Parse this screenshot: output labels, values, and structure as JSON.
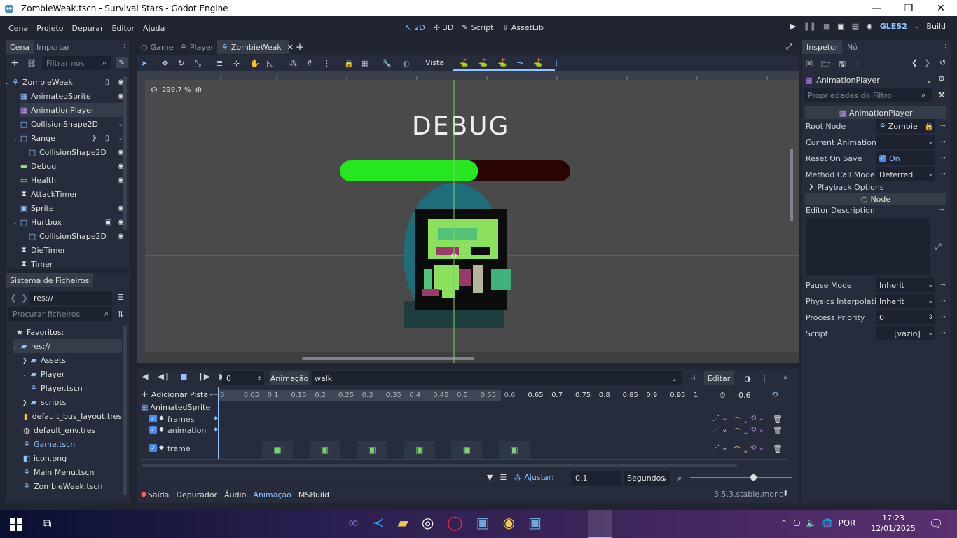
{
  "window": {
    "title": "ZombieWeak.tscn - Survival Stars - Godot Engine",
    "minimize": "—",
    "maximize": "❐",
    "close": "✕"
  },
  "menu": [
    "Cena",
    "Projeto",
    "Depurar",
    "Editor",
    "Ajuda"
  ],
  "workspaces": [
    "2D",
    "3D",
    "Script",
    "AssetLib"
  ],
  "renderer": "GLES2",
  "build_label": "Build",
  "scene_dock": {
    "tabs": [
      "Cena",
      "Importar"
    ],
    "filter_placeholder": "Filtrar nós",
    "nodes": [
      {
        "name": "ZombieWeak",
        "depth": 0,
        "icon": "kinematic-icon"
      },
      {
        "name": "AnimatedSprite",
        "depth": 1,
        "icon": "animsprite-icon"
      },
      {
        "name": "AnimationPlayer",
        "depth": 1,
        "icon": "animplayer-icon"
      },
      {
        "name": "CollisionShape2D",
        "depth": 1,
        "icon": "collision-icon"
      },
      {
        "name": "Range",
        "depth": 1,
        "icon": "area-icon"
      },
      {
        "name": "CollisionShape2D",
        "depth": 2,
        "icon": "collision-icon"
      },
      {
        "name": "Debug",
        "depth": 1,
        "icon": "label-icon"
      },
      {
        "name": "Health",
        "depth": 1,
        "icon": "progress-icon"
      },
      {
        "name": "AttackTimer",
        "depth": 1,
        "icon": "timer-icon"
      },
      {
        "name": "Sprite",
        "depth": 1,
        "icon": "sprite-icon"
      },
      {
        "name": "Hurtbox",
        "depth": 1,
        "icon": "area-icon"
      },
      {
        "name": "CollisionShape2D",
        "depth": 2,
        "icon": "collision-icon"
      },
      {
        "name": "DieTimer",
        "depth": 1,
        "icon": "timer-icon"
      },
      {
        "name": "Timer",
        "depth": 1,
        "icon": "timer-icon"
      }
    ]
  },
  "filesystem_dock": {
    "title": "Sistema de Ficheiros",
    "path": "res://",
    "search_placeholder": "Procurar ficheiros",
    "items": [
      {
        "name": "Favoritos:",
        "depth": 0,
        "icon": "star-icon"
      },
      {
        "name": "res://",
        "depth": 0,
        "icon": "folder-icon"
      },
      {
        "name": "Assets",
        "depth": 1,
        "icon": "folder-icon"
      },
      {
        "name": "Player",
        "depth": 1,
        "icon": "folder-icon"
      },
      {
        "name": "Player.tscn",
        "depth": 2,
        "icon": "scene-file-icon"
      },
      {
        "name": "scripts",
        "depth": 1,
        "icon": "folder-icon"
      },
      {
        "name": "default_bus_layout.tres",
        "depth": 1,
        "icon": "bus-icon"
      },
      {
        "name": "default_env.tres",
        "depth": 1,
        "icon": "env-icon"
      },
      {
        "name": "Game.tscn",
        "depth": 1,
        "icon": "scene-file-icon"
      },
      {
        "name": "icon.png",
        "depth": 1,
        "icon": "image-file-icon"
      },
      {
        "name": "Main Menu.tscn",
        "depth": 1,
        "icon": "scene-file-icon"
      },
      {
        "name": "ZombieWeak.tscn",
        "depth": 1,
        "icon": "scene-file-icon"
      }
    ]
  },
  "scene_tabs": [
    "Game",
    "Player",
    "ZombieWeak"
  ],
  "toolbar": {
    "view_label": "Vista"
  },
  "viewport": {
    "zoom": "299.7 %",
    "debug_label": "DEBUG",
    "health_fraction": 0.6
  },
  "animation": {
    "frame": "0",
    "anim_label": "Animação",
    "anim_name": "walk",
    "edit_label": "Editar",
    "add_track": "Adicionar Pista",
    "length": "0.6",
    "ticks": [
      "0",
      "0.05",
      "0.1",
      "0.15",
      "0.2",
      "0.25",
      "0.3",
      "0.35",
      "0.4",
      "0.45",
      "0.5",
      "0.55",
      "0.6",
      "0.65",
      "0.7",
      "0.75",
      "0.8",
      "0.85",
      "0.9",
      "0.95",
      "1"
    ],
    "track_group": "AnimatedSprite",
    "tracks": [
      "frames",
      "animation",
      "frame"
    ],
    "snap_label": "Ajustar:",
    "snap_value": "0.1",
    "snap_unit": "Segundos"
  },
  "bottom_tabs": [
    "Saída",
    "Depurador",
    "Áudio",
    "Animação",
    "MSBuild"
  ],
  "version": "3.5.3.stable.mono",
  "inspector": {
    "tabs": [
      "Inspetor",
      "Nó"
    ],
    "object": "AnimationPlayer",
    "filter_placeholder": "Propriedades do Filtro",
    "class_header": "AnimationPlayer",
    "props": [
      {
        "label": "Root Node",
        "value": "Zombie"
      },
      {
        "label": "Current Animation",
        "value": ""
      },
      {
        "label": "Reset On Save",
        "value": "On"
      },
      {
        "label": "Method Call Mode",
        "value": "Deferred"
      }
    ],
    "playback_section": "Playback Options",
    "node_header": "Node",
    "editor_description": "Editor Description",
    "props2": [
      {
        "label": "Pause Mode",
        "value": "Inherit"
      },
      {
        "label": "Physics Interpolatio",
        "value": "Inherit"
      },
      {
        "label": "Process Priority",
        "value": "0"
      },
      {
        "label": "Script",
        "value": "[vazio]"
      }
    ]
  },
  "taskbar": {
    "lang": "POR",
    "time": "17:23",
    "date": "12/01/2025"
  }
}
